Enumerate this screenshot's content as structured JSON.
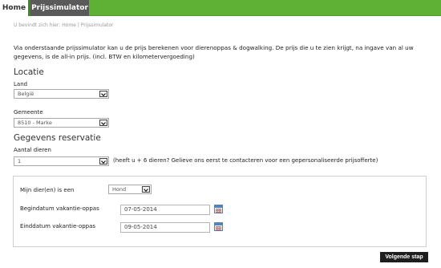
{
  "nav": {
    "home": "Home",
    "active": "Prijssimulator"
  },
  "breadcrumb": {
    "prefix": "U bevindt zich hier:",
    "home": "Home",
    "separator": "|",
    "current": "Prijssimulator"
  },
  "intro": "Via onderstaande prijssimulator kan u de prijs berekenen voor dierenoppas & dogwalking. De prijs die u te zien krijgt, na ingave van al uw gegevens, is de all-in prijs. (incl. BTW en kilometervergoeding)",
  "location": {
    "heading": "Locatie",
    "country_label": "Land",
    "country_value": "België",
    "municipality_label": "Gemeente",
    "municipality_value": "8510 - Marke"
  },
  "reservation": {
    "heading": "Gegevens reservatie",
    "animals_label": "Aantal dieren",
    "animals_value": "1",
    "note": "(heeft u + 6 dieren? Gelieve ons eerst te contacteren voor een gepersonaliseerde prijsofferte)"
  },
  "panel": {
    "animal_label": "Mijn dier(en) is een",
    "animal_value": "Hond",
    "start_label": "Begindatum vakantie-oppas",
    "start_value": "07-05-2014",
    "end_label": "Einddatum vakantie-oppas",
    "end_value": "09-05-2014"
  },
  "actions": {
    "next": "Volgende stap"
  },
  "colors": {
    "nav_green": "#5fb135",
    "nav_active": "#5a5a5a",
    "button_dark": "#1e1e1e"
  },
  "icons": {
    "select_arrow": "chevron-down-icon",
    "calendar": "calendar-icon"
  }
}
